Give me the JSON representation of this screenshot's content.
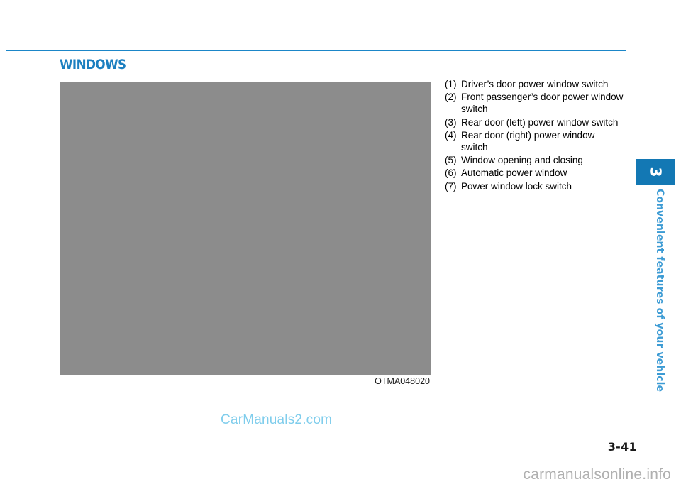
{
  "page": {
    "number": "3-41",
    "chapter_number": "3",
    "chapter_title": "Convenient features of your vehicle",
    "accent_color": "#1b86c8",
    "heading_color": "#1b7fc0",
    "tab_color": "#1378b4",
    "chapter_title_color": "#3c9bd4"
  },
  "section": {
    "heading": "WINDOWS"
  },
  "figure": {
    "caption": "OTMA048020",
    "placeholder_color": "#8c8c8c",
    "alt": "power window switch panel illustration"
  },
  "callouts": [
    {
      "num": "(1)",
      "text": "Driver’s door power window switch"
    },
    {
      "num": "(2)",
      "text": "Front passenger’s door power window switch"
    },
    {
      "num": "(3)",
      "text": "Rear door (left) power window switch"
    },
    {
      "num": "(4)",
      "text": "Rear door (right) power window switch"
    },
    {
      "num": "(5)",
      "text": "Window opening and closing"
    },
    {
      "num": "(6)",
      "text": "Automatic power window"
    },
    {
      "num": "(7)",
      "text": "Power window lock switch"
    }
  ],
  "watermarks": {
    "main": "CarManuals2.com",
    "bottom": "carmanualsonline.info"
  }
}
